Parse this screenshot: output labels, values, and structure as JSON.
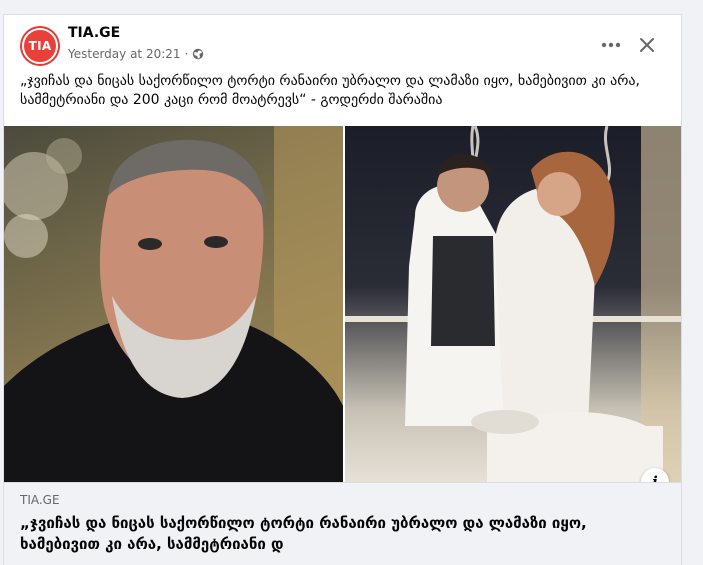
{
  "post": {
    "page_name": "TIA.GE",
    "avatar_text": "TIA",
    "timestamp": "Yesterday at 20:21",
    "separator": "·",
    "more_icon": "more-horizontal-icon",
    "close_icon": "close-icon",
    "privacy_icon": "globe-icon",
    "text": "„ჯვიჩას და ნიცას საქორწილო ტორტი რანაირი უბრალო და ლამაზი იყო, ხამებივით კი არა, სამმეტრიანი და 200 კაცი რომ მოატრევს“ - გოდერძი შარაშია"
  },
  "link_preview": {
    "domain": "TIA.GE",
    "title": "„ჯვიჩას და ნიცას საქორწილო ტორტი რანაირი უბრალო და ლამაზი იყო, ხამებივით კი არა, სამმეტრიანი დ",
    "info_label": "i"
  },
  "colors": {
    "brand": "#e53935",
    "text_primary": "#050505",
    "text_secondary": "#65676b",
    "background": "#f0f2f5"
  }
}
